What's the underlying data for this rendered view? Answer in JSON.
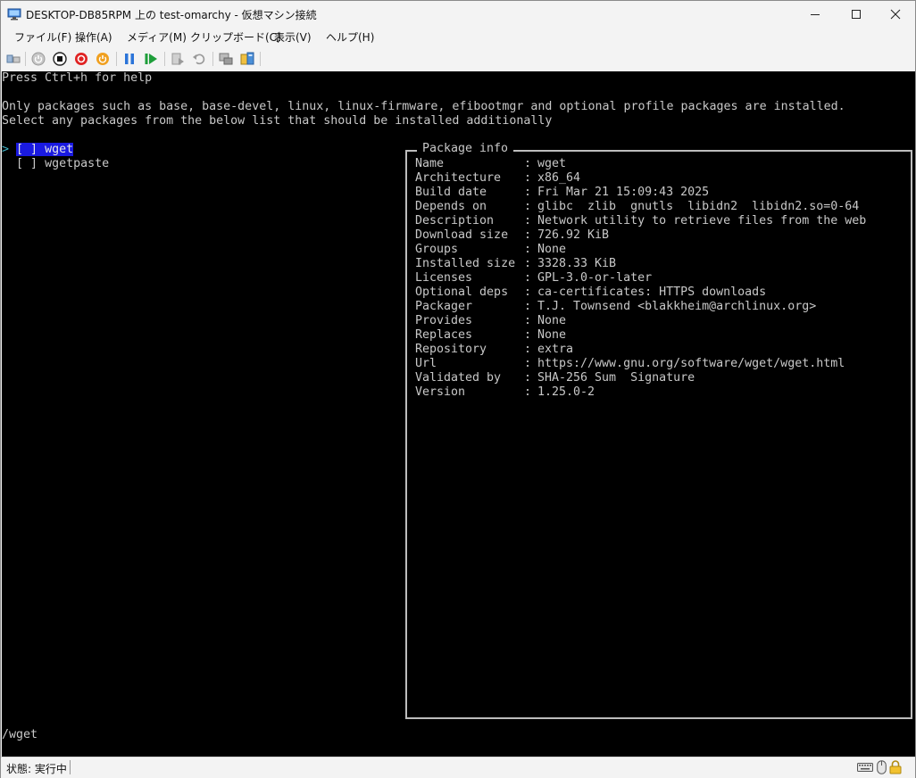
{
  "window": {
    "title": "DESKTOP-DB85RPM 上の test-omarchy - 仮想マシン接続"
  },
  "menu": {
    "items": [
      "ファイル(F)",
      "操作(A)",
      "メディア(M)",
      "クリップボード(C)",
      "表示(V)",
      "ヘルプ(H)"
    ]
  },
  "toolbar": {
    "icons": [
      "ctrl-alt-del-icon",
      "start-icon",
      "turn-off-icon",
      "shut-down-icon",
      "save-icon",
      "pause-icon",
      "resume-icon",
      "checkpoint-icon",
      "revert-icon",
      "enhanced-session-icon",
      "share-icon"
    ]
  },
  "console": {
    "help_line": "Press Ctrl+h for help",
    "intro_line1": "Only packages such as base, base-devel, linux, linux-firmware, efibootmgr and optional profile packages are installed.",
    "intro_line2": "Select any packages from the below list that should be installed additionally",
    "cursor": ">",
    "packages": [
      {
        "checkbox": "[ ]",
        "name": "wget",
        "selected": true
      },
      {
        "checkbox": "[ ]",
        "name": "wgetpaste",
        "selected": false
      }
    ],
    "search_line": "/wget",
    "package_info": {
      "legend": "Package info",
      "rows": [
        {
          "key": "Name",
          "value": "wget"
        },
        {
          "key": "Architecture",
          "value": "x86_64"
        },
        {
          "key": "Build date",
          "value": "Fri Mar 21 15:09:43 2025"
        },
        {
          "key": "Depends on",
          "value": "glibc  zlib  gnutls  libidn2  libidn2.so=0-64"
        },
        {
          "key": "Description",
          "value": "Network utility to retrieve files from the web"
        },
        {
          "key": "Download size",
          "value": "726.92 KiB"
        },
        {
          "key": "Groups",
          "value": "None"
        },
        {
          "key": "Installed size",
          "value": "3328.33 KiB"
        },
        {
          "key": "Licenses",
          "value": "GPL-3.0-or-later"
        },
        {
          "key": "Optional deps",
          "value": "ca-certificates: HTTPS downloads"
        },
        {
          "key": "Packager",
          "value": "T.J. Townsend <blakkheim@archlinux.org>"
        },
        {
          "key": "Provides",
          "value": "None"
        },
        {
          "key": "Replaces",
          "value": "None"
        },
        {
          "key": "Repository",
          "value": "extra"
        },
        {
          "key": "Url",
          "value": "https://www.gnu.org/software/wget/wget.html"
        },
        {
          "key": "Validated by",
          "value": "SHA-256 Sum  Signature"
        },
        {
          "key": "Version",
          "value": "1.25.0-2"
        }
      ]
    }
  },
  "status": {
    "text": "状態: 実行中",
    "icons": [
      "keyboard-icon",
      "mouse-icon",
      "lock-icon"
    ]
  },
  "colors": {
    "console_bg": "#000000",
    "console_fg": "#c8c8c8",
    "selection_bg": "#1a1ae0",
    "cursor": "#3fb4c7"
  }
}
